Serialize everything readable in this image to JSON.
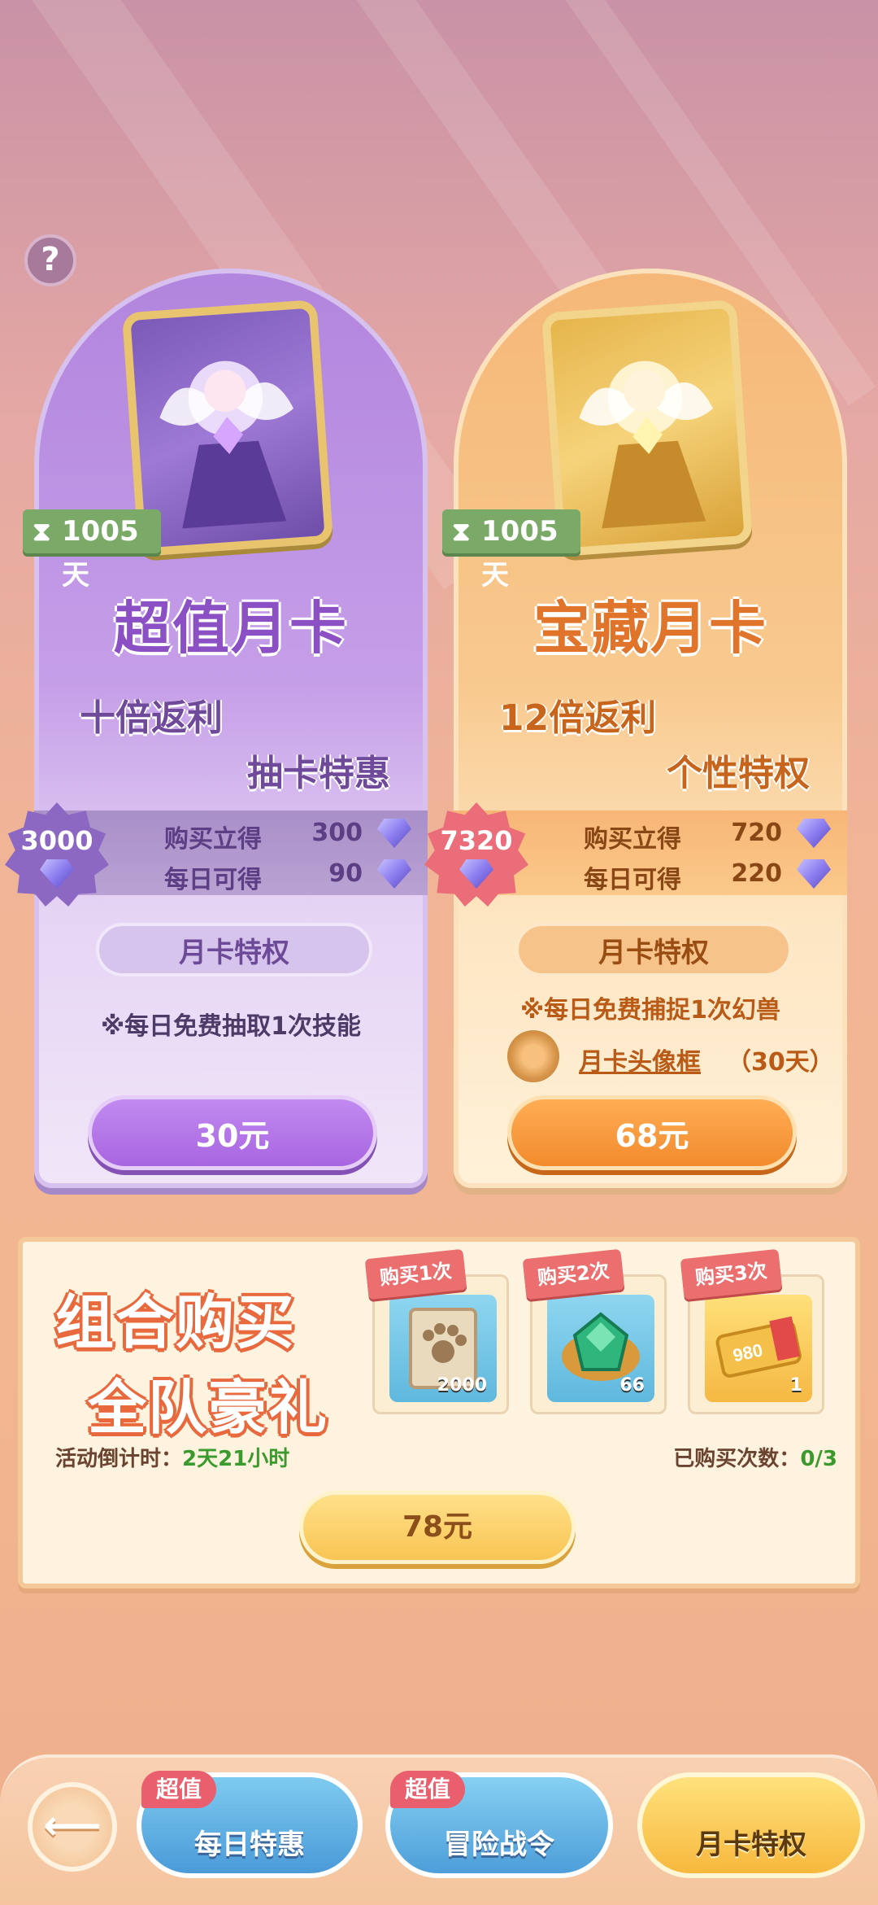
{
  "help": {
    "icon": "?"
  },
  "cards": [
    {
      "name": "超值月卡",
      "duration": "1005天",
      "slogan1": "十倍返利",
      "slogan2": "抽卡特惠",
      "total": "3000",
      "instant_label": "购买立得",
      "instant_value": "300",
      "daily_label": "每日可得",
      "daily_value": "90",
      "privilege_title": "月卡特权",
      "perk": "※每日免费抽取1次技能",
      "price": "30元",
      "color": "#8a50c4"
    },
    {
      "name": "宝藏月卡",
      "duration": "1005天",
      "slogan1": "12倍返利",
      "slogan2": "个性特权",
      "total": "7320",
      "instant_label": "购买立得",
      "instant_value": "720",
      "daily_label": "每日可得",
      "daily_value": "220",
      "privilege_title": "月卡特权",
      "perk": "※每日免费捕捉1次幻兽",
      "perk2_link": "月卡头像框",
      "perk2_suffix": "（30天）",
      "price": "68元",
      "color": "#e0742a"
    }
  ],
  "bundle": {
    "title_line1": "组合购买",
    "title_line2": "全队豪礼",
    "rewards": [
      {
        "tag": "购买1次",
        "count": "2000",
        "icon": "paw-scroll-icon"
      },
      {
        "tag": "购买2次",
        "count": "66",
        "icon": "emerald-gem-icon"
      },
      {
        "tag": "购买3次",
        "count": "1",
        "icon": "ticket-980-icon",
        "ticket_text": "980"
      }
    ],
    "countdown_label": "活动倒计时：",
    "countdown_value": "2天21小时",
    "purchased_label": "已购买次数：",
    "purchased_value": "0/3",
    "price": "78元"
  },
  "nav": {
    "back_icon": "back-arrow-icon",
    "tabs": [
      {
        "label": "每日特惠",
        "badge": "超值"
      },
      {
        "label": "冒险战令",
        "badge": "超值"
      },
      {
        "label": "月卡特权",
        "badge": ""
      }
    ]
  }
}
